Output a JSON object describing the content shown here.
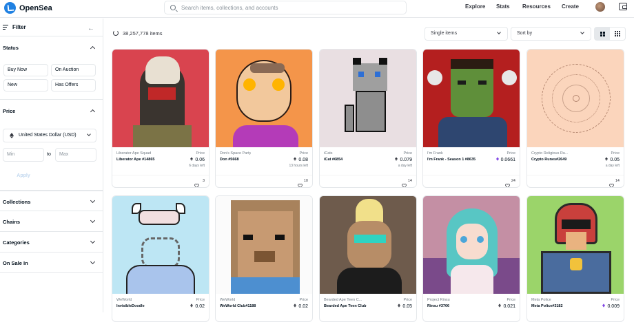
{
  "header": {
    "logo": "OpenSea",
    "search_placeholder": "Search items, collections, and accounts",
    "nav": [
      "Explore",
      "Stats",
      "Resources",
      "Create"
    ]
  },
  "sidebar": {
    "filter_label": "Filter",
    "status": {
      "title": "Status",
      "buttons": [
        "Buy Now",
        "On Auction",
        "New",
        "Has Offers"
      ]
    },
    "price": {
      "title": "Price",
      "currency": "United States Dollar (USD)",
      "min_placeholder": "Min",
      "to": "to",
      "max_placeholder": "Max",
      "apply": "Apply"
    },
    "sections": [
      "Collections",
      "Chains",
      "Categories",
      "On Sale In"
    ]
  },
  "main": {
    "items_count": "38,257,778 items",
    "item_type": "Single items",
    "sort_placeholder": "Sort by",
    "price_label": "Price",
    "cards": [
      {
        "collection": "Liberator Ape Squad",
        "name": "Liberator Ape #14865",
        "price": "0.06",
        "chain": "eth",
        "last": "6 days left",
        "likes": "3",
        "bg": "#d9444f"
      },
      {
        "collection": "Don's Space Party",
        "name": "Don #5668",
        "price": "0.08",
        "chain": "eth",
        "last": "13 hours left",
        "likes": "10",
        "bg": "#f4954a"
      },
      {
        "collection": "iCats",
        "name": "iCat #6854",
        "price": "0.079",
        "chain": "eth",
        "last": "a day left",
        "likes": "14",
        "bg": "#e9dfe2"
      },
      {
        "collection": "I'm Frank",
        "name": "I'm Frank - Season 1 #8635",
        "price": "0.0661",
        "chain": "matic",
        "last": "",
        "likes": "24",
        "bg": "#b41f1f"
      },
      {
        "collection": "Crypto Religious Ru...",
        "name": "Crypto Runes#2649",
        "price": "0.05",
        "chain": "eth",
        "last": "a day left",
        "likes": "14",
        "bg": "#fbd5bc"
      },
      {
        "collection": "WeWorld",
        "name": "InvisibleDoodle",
        "price": "0.02",
        "chain": "eth",
        "last": "",
        "likes": "",
        "bg": "#bde6f4"
      },
      {
        "collection": "WeWorld",
        "name": "WeWorld Club#1188",
        "price": "0.02",
        "chain": "eth",
        "last": "",
        "likes": "",
        "bg": "#fbfbfb"
      },
      {
        "collection": "Bearded Ape Teen C...",
        "name": "Bearded Ape Teen Club",
        "price": "0.05",
        "chain": "eth",
        "last": "",
        "likes": "",
        "bg": "#6e5b4c"
      },
      {
        "collection": "Project Rinsu",
        "name": "Rinsu #3706",
        "price": "0.021",
        "chain": "eth",
        "last": "",
        "likes": "",
        "bg": "#c48fa4"
      },
      {
        "collection": "Meta Police",
        "name": "Meta Police#3182",
        "price": "0.009",
        "chain": "matic",
        "last": "",
        "likes": "",
        "bg": "#9bd46a"
      }
    ]
  }
}
